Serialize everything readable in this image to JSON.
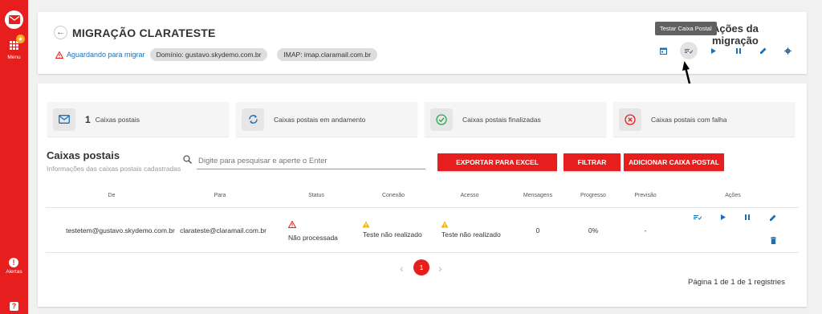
{
  "sidebar": {
    "menu_label": "Menu",
    "alerts_label": "Alertas",
    "alerts_glyph": "!",
    "help_glyph": "?",
    "menu_badge_glyph": "★",
    "accent": "#e61e1e"
  },
  "header": {
    "back_glyph": "←",
    "title": "MIGRAÇÃO CLARATESTE",
    "status": "Aguardando para migrar",
    "domain_chip": "Domínio: gustavo.skydemo.com.br",
    "imap_chip": "IMAP: imap.claramail.com.br",
    "actions_title": "Ações da migração",
    "tooltip": "Testar Caixa Postal",
    "action_icons": [
      "calendar-icon",
      "test-mailbox-icon",
      "play-icon",
      "pause-icon",
      "edit-icon",
      "gear-icon"
    ]
  },
  "stats": [
    {
      "icon": "mail-icon",
      "count": "1",
      "label": "Caixas postais",
      "color": "#1f6fb5"
    },
    {
      "icon": "sync-icon",
      "count": "",
      "label": "Caixas postais em andamento",
      "color": "#1f6fb5"
    },
    {
      "icon": "check-circle-icon",
      "count": "",
      "label": "Caixas postais finalizadas",
      "color": "#2ea44f"
    },
    {
      "icon": "error-circle-icon",
      "count": "",
      "label": "Caixas postais com falha",
      "color": "#e61e1e"
    }
  ],
  "mailboxes": {
    "title": "Caixas postais",
    "subtitle": "Informações das caixas postais cadastradas",
    "search_placeholder": "Digite para pesquisar e aperte o Enter",
    "export_label": "EXPORTAR PARA EXCEL",
    "filter_label": "FILTRAR",
    "add_label": "ADICIONAR CAIXA POSTAL",
    "columns": {
      "de": "De",
      "para": "Para",
      "status": "Status",
      "conexao": "Conexão",
      "acesso": "Acesso",
      "mensagens": "Mensagens",
      "progresso": "Progresso",
      "previsao": "Previsão",
      "acoes": "Ações"
    },
    "row": {
      "de": "testetem@gustavo.skydemo.com.br",
      "para": "clarateste@claramail.com.br",
      "status": "Não processada",
      "conexao": "Teste não realizado",
      "acesso": "Teste não realizado",
      "mensagens": "0",
      "progresso": "0%",
      "previsao": "-",
      "action_icons": [
        "test-mailbox-icon",
        "play-icon",
        "pause-icon",
        "edit-icon",
        "delete-icon"
      ]
    }
  },
  "pagination": {
    "prev_glyph": "‹",
    "next_glyph": "›",
    "current_page": "1",
    "info": "Página 1 de 1 de 1 registries"
  }
}
